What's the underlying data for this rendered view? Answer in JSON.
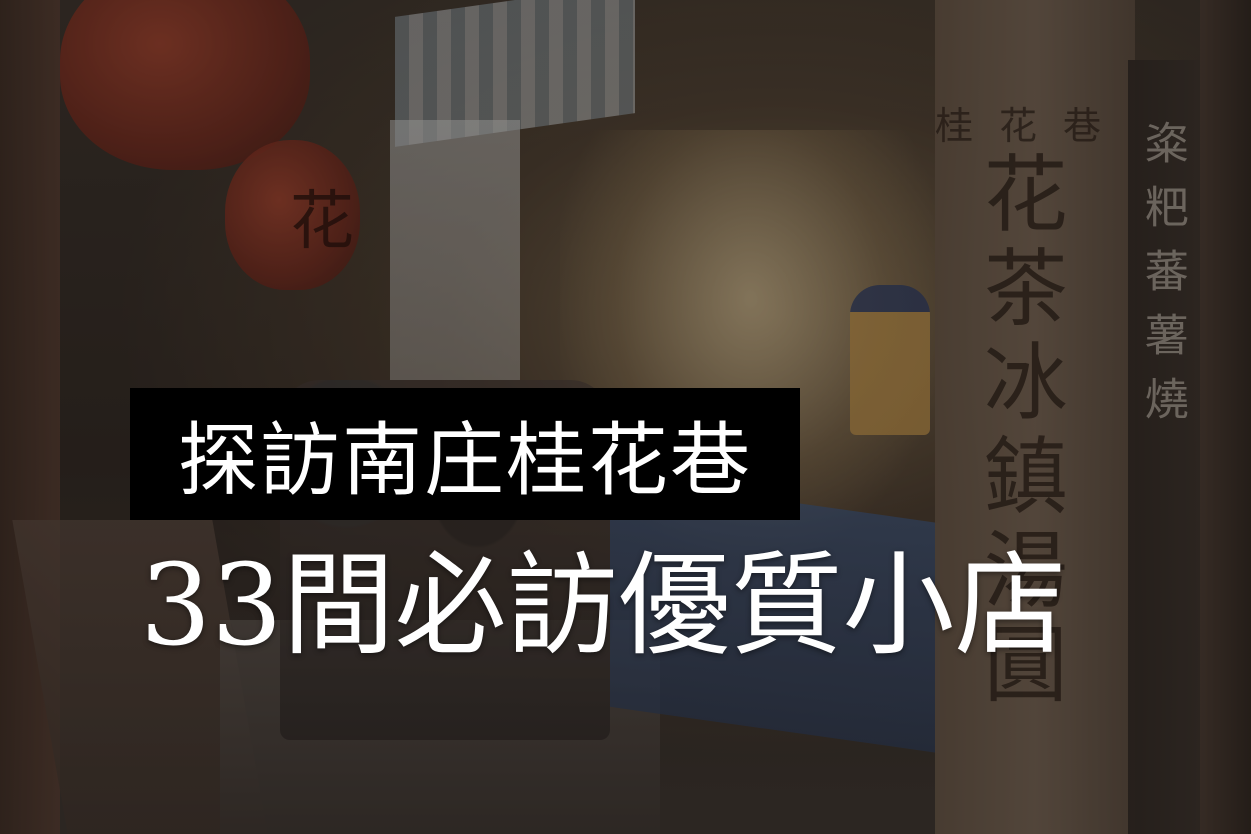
{
  "overlay": {
    "title": "探訪南庄桂花巷",
    "subtitle": "33間必訪優質小店"
  },
  "scene_signs": {
    "lantern_char": "花",
    "sign_top": "桂花巷",
    "sign_main": "花茶冰鎮湯圓",
    "sign_side": "粢粑蕃薯燒"
  },
  "colors": {
    "title_box_bg": "#000000",
    "title_text": "#ffffff",
    "subtitle_text": "#ffffff"
  }
}
